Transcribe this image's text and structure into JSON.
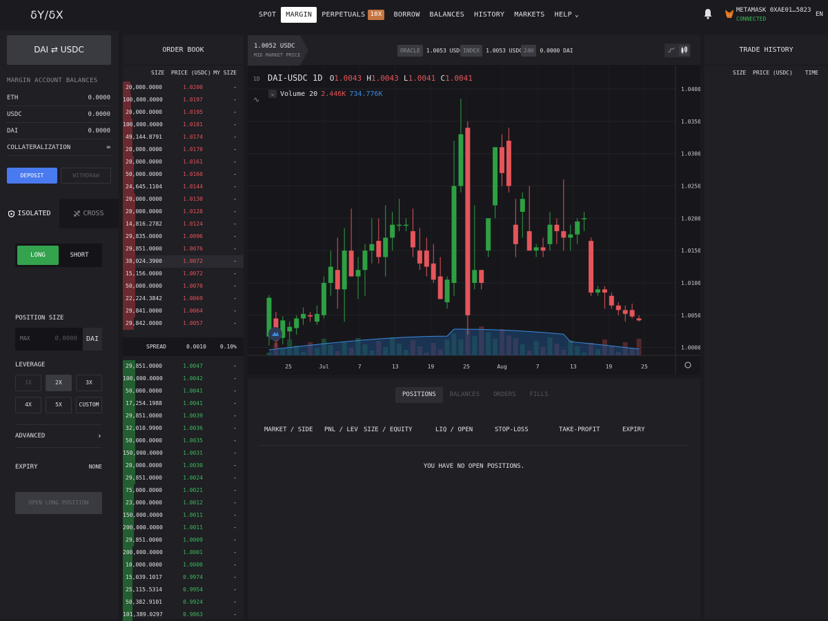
{
  "app": {
    "logo": "δY/δX",
    "nav": [
      {
        "label": "SPOT"
      },
      {
        "label": "MARGIN",
        "active": true
      },
      {
        "label": "PERPETUALS",
        "badge": "10X"
      },
      {
        "label": "BORROW"
      },
      {
        "label": "BALANCES"
      },
      {
        "label": "HISTORY"
      },
      {
        "label": "MARKETS"
      },
      {
        "label": "HELP"
      }
    ],
    "wallet": {
      "address": "METAMASK 0XAE01…5823",
      "status": "CONNECTED"
    },
    "lang": "EN"
  },
  "left": {
    "pair": "DAI ⇄ USDC",
    "balances_title": "MARGIN ACCOUNT BALANCES",
    "balances": [
      {
        "label": "ETH",
        "value": "0.0000"
      },
      {
        "label": "USDC",
        "value": "0.0000"
      },
      {
        "label": "DAI",
        "value": "0.0000"
      },
      {
        "label": "COLLATERALIZATION",
        "value": "∞"
      }
    ],
    "deposit": "DEPOSIT",
    "withdraw": "WITHDRAW",
    "mode_tabs": [
      "ISOLATED",
      "CROSS"
    ],
    "side": {
      "long": "LONG",
      "short": "SHORT"
    },
    "position_size_label": "POSITION SIZE",
    "size_max": "MAX",
    "size_placeholder": "0.0000",
    "size_unit": "DAI",
    "leverage_label": "LEVERAGE",
    "leverage_options": [
      "1X",
      "2X",
      "3X",
      "4X",
      "5X",
      "CUSTOM"
    ],
    "advanced": "ADVANCED",
    "expiry_label": "EXPIRY",
    "expiry_value": "NONE",
    "open_btn": "OPEN LONG POSITION"
  },
  "orderbook": {
    "title": "ORDER BOOK",
    "headers": [
      "SIZE",
      "PRICE (USDC)",
      "MY SIZE"
    ],
    "asks": [
      {
        "size": "20,000.0000",
        "price": "1.0200",
        "my": "-",
        "depth": 0.06
      },
      {
        "size": "100,000.0000",
        "price": "1.0197",
        "my": "-",
        "depth": 0.07
      },
      {
        "size": "20,000.0000",
        "price": "1.0195",
        "my": "-",
        "depth": 0.07
      },
      {
        "size": "100,000.0000",
        "price": "1.0181",
        "my": "-",
        "depth": 0.08
      },
      {
        "size": "49,144.8791",
        "price": "1.0174",
        "my": "-",
        "depth": 0.08
      },
      {
        "size": "20,000.0000",
        "price": "1.0170",
        "my": "-",
        "depth": 0.08
      },
      {
        "size": "20,000.0000",
        "price": "1.0161",
        "my": "-",
        "depth": 0.09
      },
      {
        "size": "50,000.0000",
        "price": "1.0160",
        "my": "-",
        "depth": 0.09
      },
      {
        "size": "24,645.1104",
        "price": "1.0144",
        "my": "-",
        "depth": 0.09
      },
      {
        "size": "20,000.0000",
        "price": "1.0130",
        "my": "-",
        "depth": 0.1
      },
      {
        "size": "20,000.0000",
        "price": "1.0128",
        "my": "-",
        "depth": 0.1
      },
      {
        "size": "14,816.2782",
        "price": "1.0124",
        "my": "-",
        "depth": 0.1
      },
      {
        "size": "29,835.0000",
        "price": "1.0096",
        "my": "-",
        "depth": 0.1
      },
      {
        "size": "29,851.0000",
        "price": "1.0076",
        "my": "-",
        "depth": 0.1
      },
      {
        "size": "38,024.3900",
        "price": "1.0072",
        "my": "-",
        "depth": 0.1
      },
      {
        "size": "15,156.0000",
        "price": "1.0072",
        "my": "-",
        "depth": 0.1
      },
      {
        "size": "50,000.0000",
        "price": "1.0070",
        "my": "-",
        "depth": 0.1
      },
      {
        "size": "22,224.3842",
        "price": "1.0069",
        "my": "-",
        "depth": 0.1
      },
      {
        "size": "29,841.0000",
        "price": "1.0064",
        "my": "-",
        "depth": 0.1
      },
      {
        "size": "29,842.0000",
        "price": "1.0057",
        "my": "-",
        "depth": 0.09
      }
    ],
    "spread": {
      "label": "SPREAD",
      "value": "0.0010",
      "pct": "0.10%"
    },
    "bids": [
      {
        "size": "29,851.0000",
        "price": "1.0047",
        "my": "-",
        "depth": 0.1
      },
      {
        "size": "100,000.0000",
        "price": "1.0042",
        "my": "-",
        "depth": 0.1
      },
      {
        "size": "50,000.0000",
        "price": "1.0041",
        "my": "-",
        "depth": 0.1
      },
      {
        "size": "17,254.1988",
        "price": "1.0041",
        "my": "-",
        "depth": 0.1
      },
      {
        "size": "29,851.0000",
        "price": "1.0039",
        "my": "-",
        "depth": 0.1
      },
      {
        "size": "32,010.9900",
        "price": "1.0036",
        "my": "-",
        "depth": 0.1
      },
      {
        "size": "50,000.0000",
        "price": "1.0035",
        "my": "-",
        "depth": 0.1
      },
      {
        "size": "150,000.0000",
        "price": "1.0031",
        "my": "-",
        "depth": 0.1
      },
      {
        "size": "20,000.0000",
        "price": "1.0030",
        "my": "-",
        "depth": 0.1
      },
      {
        "size": "29,851.0000",
        "price": "1.0024",
        "my": "-",
        "depth": 0.1
      },
      {
        "size": "75,000.0000",
        "price": "1.0021",
        "my": "-",
        "depth": 0.09
      },
      {
        "size": "23,000.0000",
        "price": "1.0012",
        "my": "-",
        "depth": 0.09
      },
      {
        "size": "150,000.0000",
        "price": "1.0011",
        "my": "-",
        "depth": 0.09
      },
      {
        "size": "200,000.0000",
        "price": "1.0011",
        "my": "-",
        "depth": 0.09
      },
      {
        "size": "29,851.0000",
        "price": "1.0009",
        "my": "-",
        "depth": 0.09
      },
      {
        "size": "200,000.0000",
        "price": "1.0001",
        "my": "-",
        "depth": 0.08
      },
      {
        "size": "10,000.0000",
        "price": "1.0000",
        "my": "-",
        "depth": 0.08
      },
      {
        "size": "15,039.1017",
        "price": "0.9974",
        "my": "-",
        "depth": 0.08
      },
      {
        "size": "25,115.5314",
        "price": "0.9954",
        "my": "-",
        "depth": 0.08
      },
      {
        "size": "50,382.9101",
        "price": "0.9924",
        "my": "-",
        "depth": 0.08
      },
      {
        "size": "101,389.0297",
        "price": "0.9863",
        "my": "-",
        "depth": 0.08
      }
    ]
  },
  "chart": {
    "mid_price": "1.0052 USDC",
    "mid_label": "MID MARKET PRICE",
    "stats": [
      {
        "tag": "ORACLE",
        "value": "1.0053 USDC"
      },
      {
        "tag": "INDEX",
        "value": "1.0053 USDC"
      },
      {
        "tag": "24H",
        "value": "0.0000 DAI"
      }
    ],
    "timeframe": "1D",
    "symbol": "DAI-USDC",
    "interval": "1D",
    "ohlc": {
      "o": "1.0043",
      "h": "1.0043",
      "l": "1.0041",
      "c": "1.0041"
    },
    "volume_label": "Volume 20",
    "volume_a": "2.446K",
    "volume_b": "734.776K",
    "colors": {
      "up": "#2ea043",
      "down": "#e5555a",
      "vol_ma": "#3a8be0"
    }
  },
  "chart_data": {
    "type": "candlestick",
    "y_ticks": [
      "1.0400",
      "1.0350",
      "1.0300",
      "1.0250",
      "1.0200",
      "1.0150",
      "1.0100",
      "1.0050",
      "1.0000"
    ],
    "ylim": [
      0.999,
      1.0415
    ],
    "x_ticks": [
      "25",
      "Jul",
      "7",
      "13",
      "19",
      "25",
      "Aug",
      "7",
      "13",
      "19",
      "25"
    ],
    "candles": [
      [
        1.0017,
        1.0081,
        1.0003,
        1.0077
      ],
      [
        1.0045,
        1.0055,
        1.0,
        1.001
      ],
      [
        1.0015,
        1.0048,
        1.0005,
        1.0042
      ],
      [
        1.0025,
        1.004,
        1.0012,
        1.0032
      ],
      [
        1.003,
        1.005,
        1.002,
        1.0045
      ],
      [
        1.0045,
        1.0062,
        1.0035,
        1.0052
      ],
      [
        1.005,
        1.0055,
        1.004,
        1.0048
      ],
      [
        1.004,
        1.0065,
        1.0035,
        1.0052
      ],
      [
        1.005,
        1.011,
        1.0045,
        1.01
      ],
      [
        1.01,
        1.015,
        1.008,
        1.0125
      ],
      [
        1.012,
        1.017,
        1.006,
        1.009
      ],
      [
        1.009,
        1.0185,
        1.004,
        1.015
      ],
      [
        1.015,
        1.0215,
        1.011,
        1.011
      ],
      [
        1.011,
        1.014,
        1.0075,
        1.012
      ],
      [
        1.012,
        1.016,
        1.008,
        1.015
      ],
      [
        1.015,
        1.02,
        1.013,
        1.016
      ],
      [
        1.0165,
        1.02,
        1.013,
        1.014
      ],
      [
        1.014,
        1.022,
        1.011,
        1.017
      ],
      [
        1.017,
        1.021,
        1.015,
        1.019
      ],
      [
        1.019,
        1.023,
        1.018,
        1.019
      ],
      [
        1.019,
        1.02,
        1.018,
        1.019
      ],
      [
        1.018,
        1.0215,
        1.014,
        1.0155
      ],
      [
        1.015,
        1.0185,
        1.012,
        1.013
      ],
      [
        1.015,
        1.017,
        1.011,
        1.0125
      ],
      [
        1.013,
        1.016,
        1.01,
        1.0105
      ],
      [
        1.011,
        1.014,
        1.008,
        1.0075
      ],
      [
        1.007,
        1.011,
        1.006,
        1.0105
      ],
      [
        1.01,
        1.032,
        1.008,
        1.025
      ],
      [
        1.025,
        1.0385,
        1.024,
        1.033
      ],
      [
        1.034,
        1.035,
        1.002,
        1.005
      ],
      [
        1.01,
        1.022,
        1.009,
        1.012
      ],
      [
        1.012,
        1.012,
        1.009,
        1.01
      ],
      [
        1.015,
        1.02,
        1.014,
        1.02
      ],
      [
        1.022,
        1.031,
        1.02,
        1.031
      ],
      [
        1.031,
        1.033,
        1.025,
        1.027
      ],
      [
        1.032,
        1.034,
        1.024,
        1.025
      ],
      [
        1.019,
        1.023,
        1.014,
        1.016
      ],
      [
        1.021,
        1.024,
        1.017,
        1.023
      ],
      [
        1.018,
        1.025,
        1.015,
        1.015
      ],
      [
        1.015,
        1.016,
        1.014,
        1.0155
      ],
      [
        1.0155,
        1.017,
        1.014,
        1.015
      ],
      [
        1.016,
        1.021,
        1.015,
        1.019
      ],
      [
        1.019,
        1.02,
        1.016,
        1.018
      ],
      [
        1.018,
        1.026,
        1.015,
        1.017
      ],
      [
        1.017,
        1.019,
        1.015,
        1.0175
      ],
      [
        1.0175,
        1.02,
        1.016,
        1.0195
      ],
      [
        1.02,
        1.021,
        1.018,
        1.02
      ],
      [
        1.0165,
        1.017,
        1.008,
        1.0085
      ],
      [
        1.0085,
        1.0095,
        1.008,
        1.009
      ],
      [
        1.009,
        1.0095,
        1.006,
        1.0085
      ],
      [
        1.008,
        1.0085,
        1.006,
        1.0065
      ],
      [
        1.0065,
        1.007,
        1.005,
        1.0058
      ],
      [
        1.0058,
        1.0065,
        1.004,
        1.0052
      ],
      [
        1.0058,
        1.0068,
        1.0045,
        1.0048
      ],
      [
        1.0045,
        1.005,
        1.004,
        1.0042
      ]
    ]
  },
  "positions": {
    "tabs": [
      "POSITIONS",
      "BALANCES",
      "ORDERS",
      "FILLS"
    ],
    "headers": [
      "MARKET / SIDE",
      "PNL / LEV",
      "SIZE / EQUITY",
      "LIQ / OPEN",
      "STOP-LOSS",
      "TAKE-PROFIT",
      "EXPIRY"
    ],
    "empty": "YOU HAVE NO OPEN POSITIONS."
  },
  "trades": {
    "title": "TRADE HISTORY",
    "headers": [
      "SIZE",
      "PRICE (USDC)",
      "TIME"
    ]
  }
}
